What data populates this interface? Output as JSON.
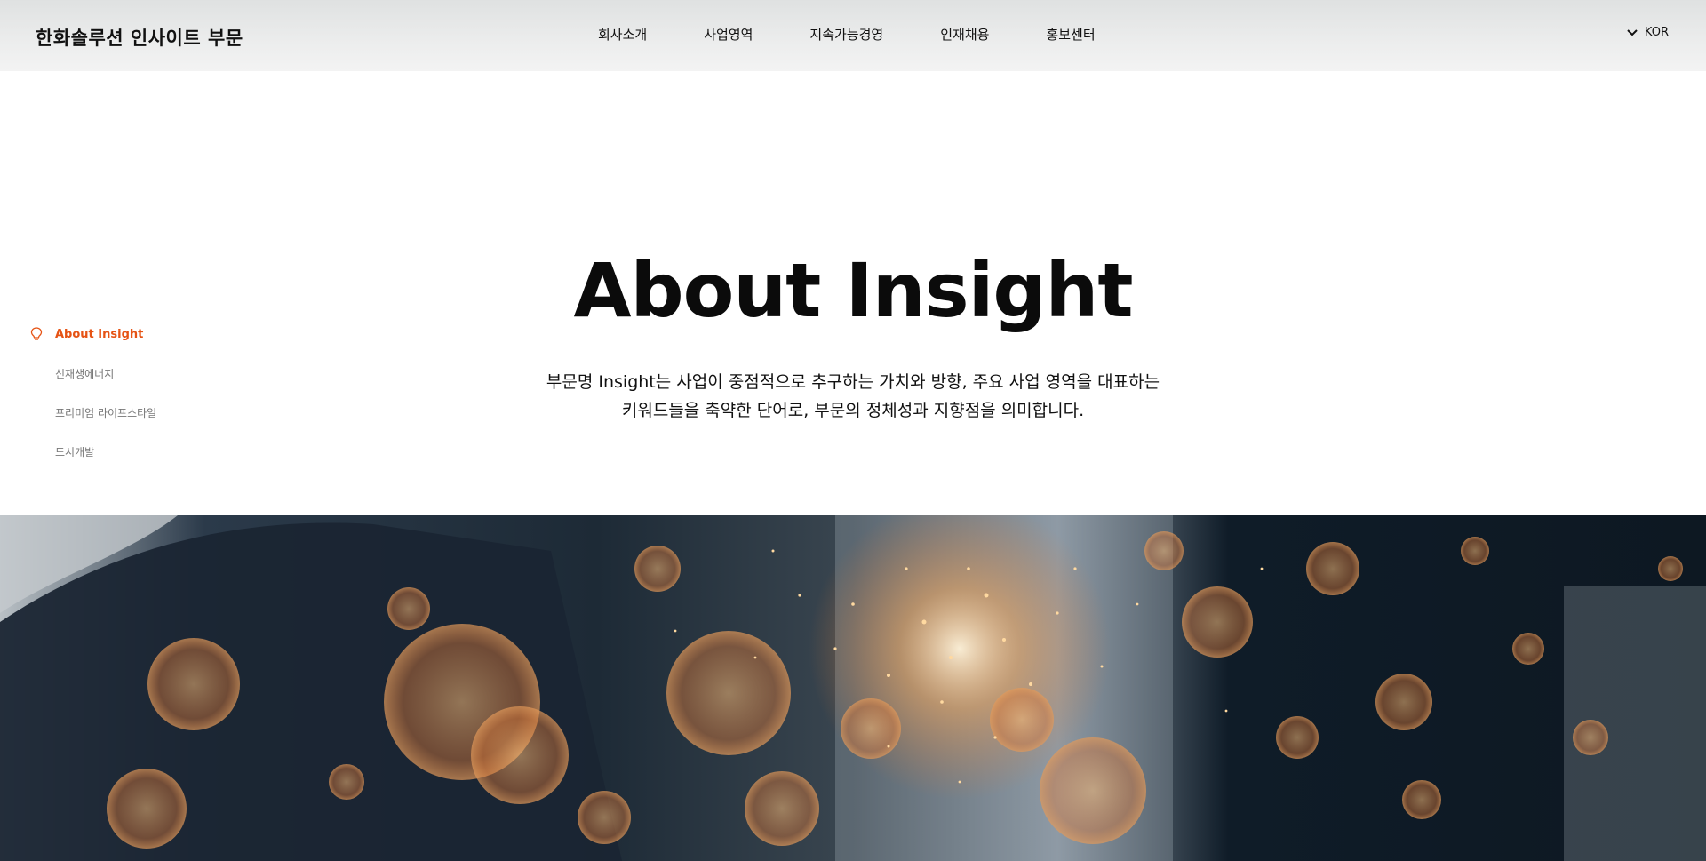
{
  "header": {
    "logo": "한화솔루션 인사이트 부문",
    "nav": [
      "회사소개",
      "사업영역",
      "지속가능경영",
      "인재채용",
      "홍보센터"
    ],
    "language": "KOR"
  },
  "side_nav": {
    "items": [
      {
        "label": "About Insight",
        "active": true,
        "icon": "lightbulb-icon"
      },
      {
        "label": "신재생에너지",
        "active": false
      },
      {
        "label": "프리미엄 라이프스타일",
        "active": false
      },
      {
        "label": "도시개발",
        "active": false
      }
    ]
  },
  "hero": {
    "title": "About Insight",
    "description_line1": "부문명 Insight는  사업이 중점적으로 추구하는 가치와 방향,  주요 사업 영역을 대표하는",
    "description_line2": "키워드들을 축약한 단어로, 부문의 정체성과  지향점을  의미합니다."
  },
  "colors": {
    "accent": "#e65314",
    "header_bg": "#e6e7e7",
    "text": "#111111"
  }
}
